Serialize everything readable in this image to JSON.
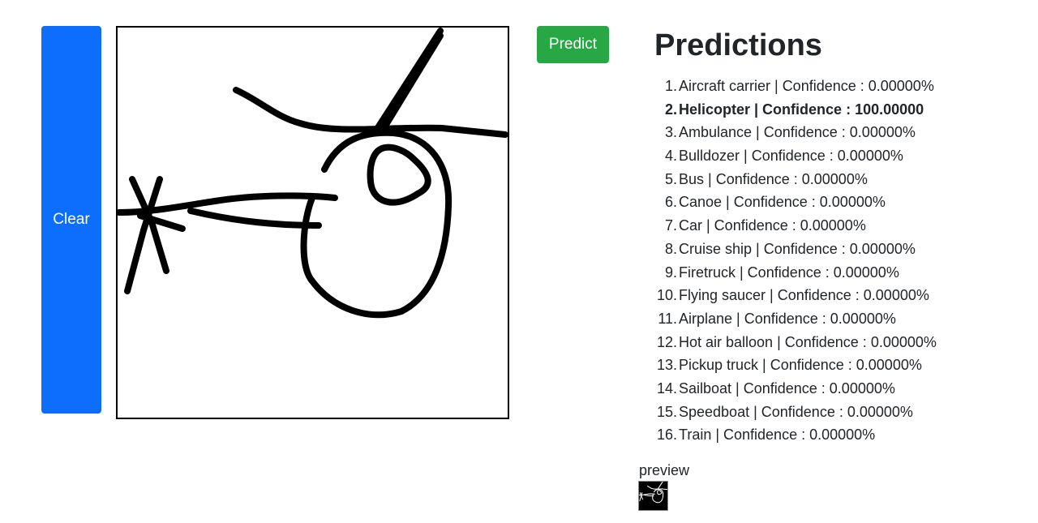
{
  "controls": {
    "clear_label": "Clear",
    "predict_label": "Predict"
  },
  "predictions": {
    "title": "Predictions",
    "items": [
      {
        "num": "1.",
        "text": "Aircraft carrier | Confidence : 0.00000%"
      },
      {
        "num": "2.",
        "text": "Helicopter | Confidence : 100.00000"
      },
      {
        "num": "3.",
        "text": "Ambulance | Confidence : 0.00000%"
      },
      {
        "num": "4.",
        "text": "Bulldozer | Confidence : 0.00000%"
      },
      {
        "num": "5.",
        "text": "Bus | Confidence : 0.00000%"
      },
      {
        "num": "6.",
        "text": "Canoe | Confidence : 0.00000%"
      },
      {
        "num": "7.",
        "text": "Car | Confidence : 0.00000%"
      },
      {
        "num": "8.",
        "text": "Cruise ship | Confidence : 0.00000%"
      },
      {
        "num": "9.",
        "text": "Firetruck | Confidence : 0.00000%"
      },
      {
        "num": "10.",
        "text": "Flying saucer | Confidence : 0.00000%"
      },
      {
        "num": "11.",
        "text": "Airplane | Confidence : 0.00000%"
      },
      {
        "num": "12.",
        "text": "Hot air balloon | Confidence : 0.00000%"
      },
      {
        "num": "13.",
        "text": "Pickup truck | Confidence : 0.00000%"
      },
      {
        "num": "14.",
        "text": "Sailboat | Confidence : 0.00000%"
      },
      {
        "num": "15.",
        "text": "Speedboat | Confidence : 0.00000%"
      },
      {
        "num": "16.",
        "text": "Train | Confidence : 0.00000%"
      }
    ]
  },
  "preview": {
    "label": "preview"
  },
  "colors": {
    "clear_button": "#0d6efd",
    "predict_button": "#28a745",
    "stroke": "#000000"
  }
}
